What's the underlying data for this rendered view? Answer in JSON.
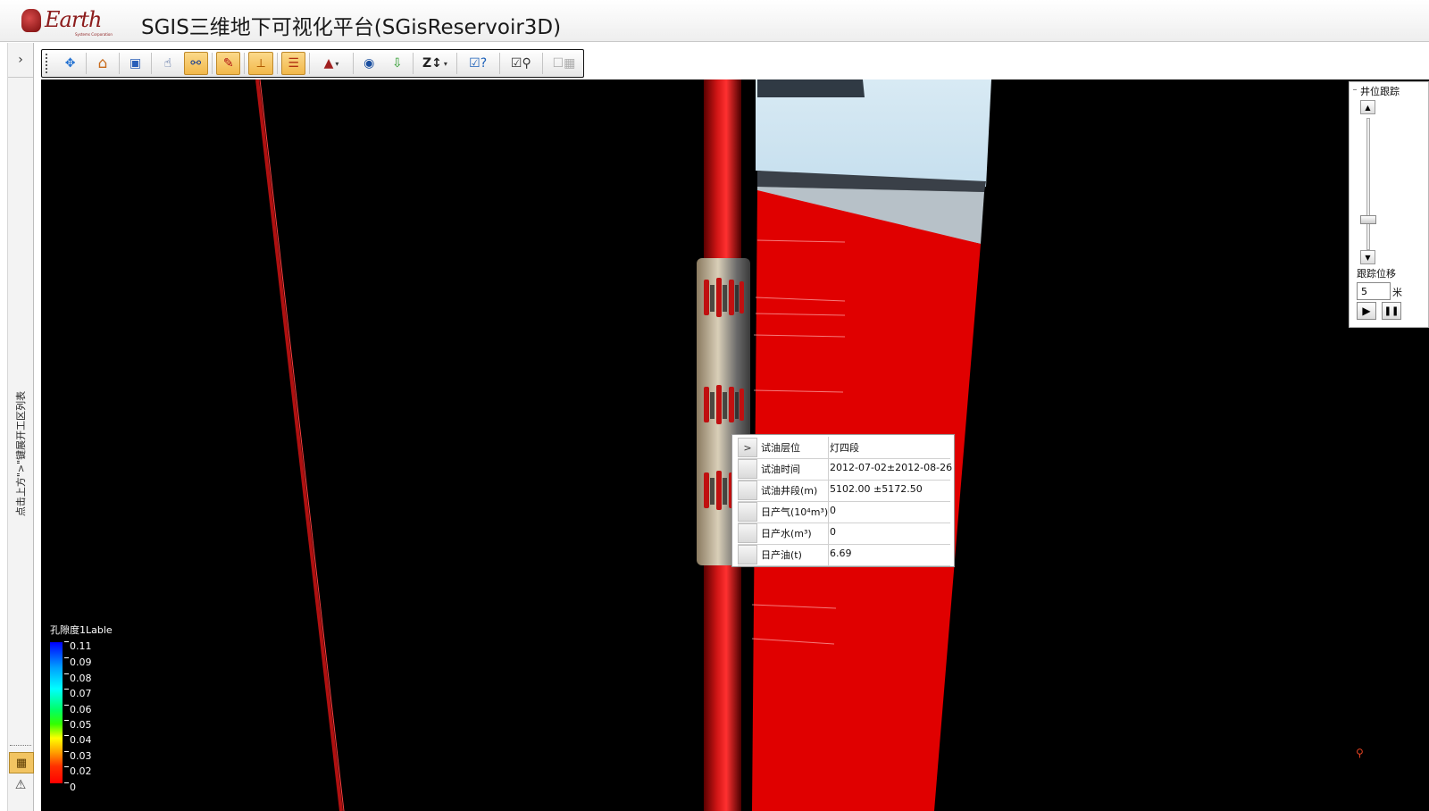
{
  "app": {
    "logo_text": "Earth",
    "logo_sub": "Systems Corporation",
    "title": "SGIS三维地下可视化平台(SGisReservoir3D)"
  },
  "left_panel": {
    "expand_glyph": "›",
    "vertical_label": "点击上方\">\"键展开工区列表"
  },
  "toolbar": {
    "buttons": [
      {
        "name": "pan-tool",
        "icon": "✥"
      },
      {
        "name": "home-view",
        "icon": "⌂"
      },
      {
        "name": "cube-view",
        "icon": "▣"
      },
      {
        "name": "select-tool",
        "icon": "☝"
      },
      {
        "name": "well-connect",
        "icon": "⚯"
      },
      {
        "name": "compass-tool",
        "icon": "✎"
      },
      {
        "name": "measure-tool",
        "icon": "⟂"
      },
      {
        "name": "layers-tool",
        "icon": "☰"
      },
      {
        "name": "render-mode",
        "icon": "▲"
      },
      {
        "name": "eye-view",
        "icon": "◉"
      },
      {
        "name": "fly-down",
        "icon": "⇩"
      },
      {
        "name": "z-scale",
        "icon": "Z↕"
      },
      {
        "name": "info-toggle",
        "icon": "☑?"
      },
      {
        "name": "track-toggle",
        "icon": "☑⚲"
      },
      {
        "name": "table-toggle",
        "icon": "☐▦"
      }
    ]
  },
  "popup": {
    "rows": [
      {
        "key": "试油层位",
        "value": "灯四段",
        "marker": ">"
      },
      {
        "key": "试油时间",
        "value": "2012-07-02±2012-08-26",
        "marker": ""
      },
      {
        "key": "试油井段(m)",
        "value": "5102.00 ±5172.50",
        "marker": ""
      },
      {
        "key": "日产气(10⁴m³)",
        "value": "0",
        "marker": ""
      },
      {
        "key": "日产水(m³)",
        "value": "0",
        "marker": ""
      },
      {
        "key": "日产油(t)",
        "value": "6.69",
        "marker": ""
      }
    ]
  },
  "legend": {
    "title": "孔隙度1Lable",
    "ticks": [
      "0.11",
      "0.09",
      "0.08",
      "0.07",
      "0.06",
      "0.05",
      "0.04",
      "0.03",
      "0.02",
      "0"
    ]
  },
  "track_panel": {
    "title": "井位跟踪",
    "offset_label": "跟踪位移",
    "offset_value": "5",
    "offset_unit": "米",
    "slider_position": 0.79
  },
  "colors": {
    "viewport_bg": "#000000",
    "formation_red": "#e00000",
    "sky_blue": "#cfe4f0",
    "well_red": "#c01010"
  }
}
